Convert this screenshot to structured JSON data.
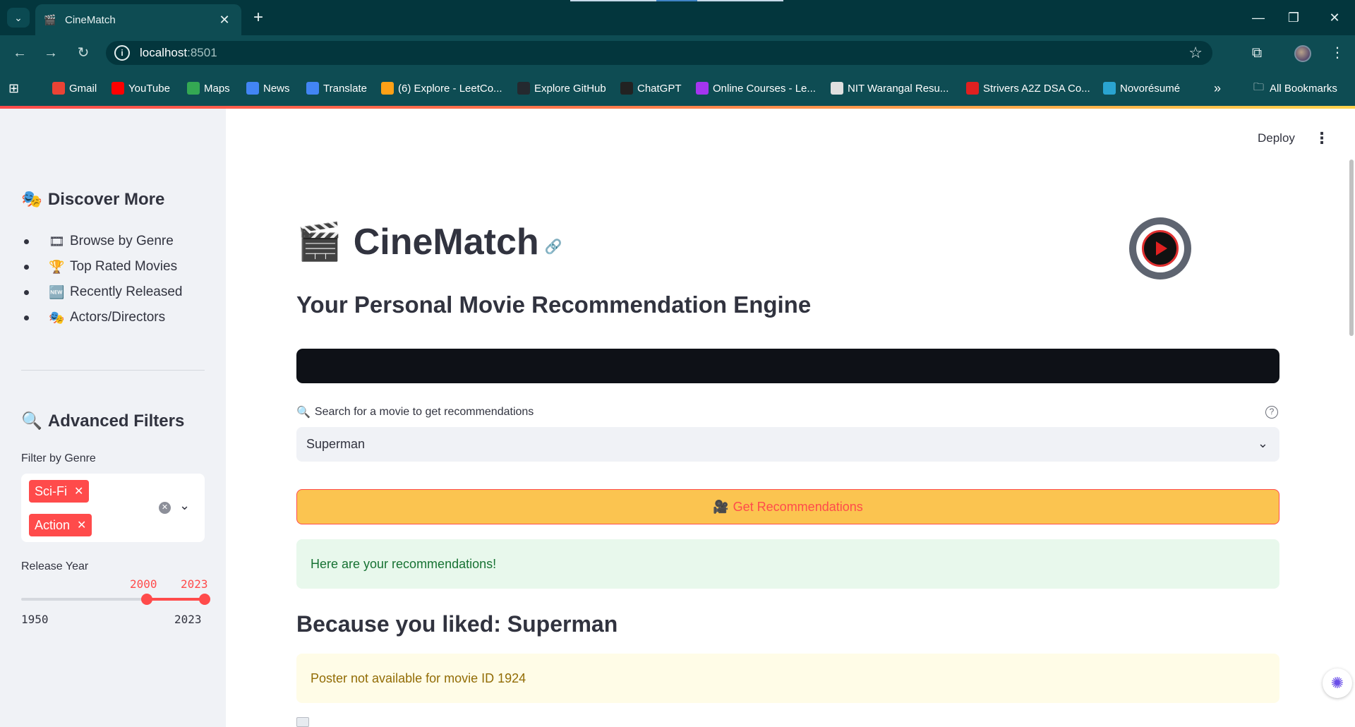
{
  "browser": {
    "tab_title": "CineMatch",
    "url_host": "localhost",
    "url_port": ":8501",
    "bookmarks": [
      {
        "label": "Gmail",
        "icon": "gmail-icon",
        "color": "#ea4335"
      },
      {
        "label": "YouTube",
        "icon": "youtube-icon",
        "color": "#ff0000"
      },
      {
        "label": "Maps",
        "icon": "maps-icon",
        "color": "#34a853"
      },
      {
        "label": "News",
        "icon": "news-icon",
        "color": "#4285f4"
      },
      {
        "label": "Translate",
        "icon": "translate-icon",
        "color": "#4285f4"
      },
      {
        "label": "(6) Explore - LeetCo...",
        "icon": "leetcode-icon",
        "color": "#ffa116"
      },
      {
        "label": "Explore GitHub",
        "icon": "github-icon",
        "color": "#24292f"
      },
      {
        "label": "ChatGPT",
        "icon": "chatgpt-icon",
        "color": "#222222"
      },
      {
        "label": "Online Courses - Le...",
        "icon": "udemy-icon",
        "color": "#a435f0"
      },
      {
        "label": "NIT Warangal Resu...",
        "icon": "nitw-icon",
        "color": "#e0e0e0"
      },
      {
        "label": "Strivers A2Z DSA Co...",
        "icon": "tuf-icon",
        "color": "#e02020"
      },
      {
        "label": "Novorésumé",
        "icon": "novoresume-icon",
        "color": "#2aa4d0"
      }
    ],
    "all_bookmarks": "All Bookmarks"
  },
  "header": {
    "deploy_label": "Deploy"
  },
  "sidebar": {
    "discover_title": "Discover More",
    "discover_emoji": "🎭",
    "discover_items": [
      {
        "emoji": "🎞",
        "label": "Browse by Genre"
      },
      {
        "emoji": "🏆",
        "label": "Top Rated Movies"
      },
      {
        "emoji": "🆕",
        "label": "Recently Released"
      },
      {
        "emoji": "🎭",
        "label": "Actors/Directors"
      }
    ],
    "filters_title": "Advanced Filters",
    "filters_emoji": "🔍",
    "genre_label": "Filter by Genre",
    "genres_selected": [
      "Sci-Fi",
      "Action"
    ],
    "year_label": "Release Year",
    "year_range": {
      "low": "2000",
      "high": "2023"
    },
    "year_bounds": {
      "min": "1950",
      "max": "2023"
    }
  },
  "main": {
    "title_emoji": "🎬",
    "title": "CineMatch",
    "subtitle": "Your Personal Movie Recommendation Engine",
    "search_emoji": "🔍",
    "search_label": "Search for a movie to get recommendations",
    "selected_movie": "Superman",
    "button_emoji": "🎥",
    "button_label": "Get Recommendations",
    "success_message": "Here are your recommendations!",
    "section_heading": "Because you liked: Superman",
    "warning_message": "Poster not available for movie ID 1924"
  },
  "colors": {
    "accent": "#ff4b4b",
    "button_bg": "#fbc450",
    "chrome": "#0e4c53"
  }
}
